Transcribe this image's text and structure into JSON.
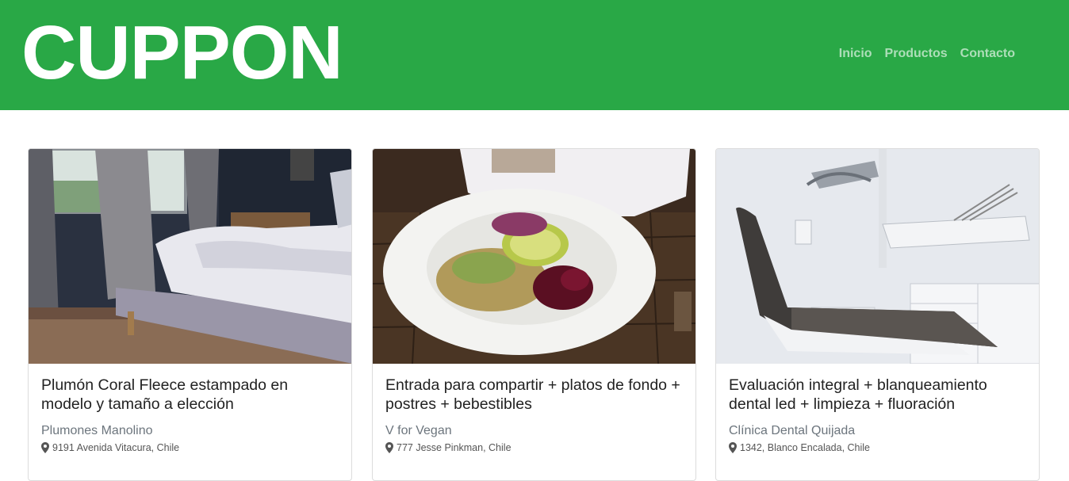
{
  "header": {
    "logo": "CUPPON",
    "nav": [
      {
        "label": "Inicio"
      },
      {
        "label": "Productos"
      },
      {
        "label": "Contacto"
      }
    ]
  },
  "colors": {
    "brand_green": "#29a846",
    "nav_link": "rgba(255,255,255,0.62)",
    "muted_text": "#6c757d"
  },
  "cards": [
    {
      "image": "bedroom-bed-photo",
      "title": "Plumón Coral Fleece estampado en modelo y tamaño a elección",
      "seller": "Plumones Manolino",
      "location": "9191 Avenida Vitacura, Chile",
      "location_icon": "map-marker-icon"
    },
    {
      "image": "vegan-salad-bowl-photo",
      "title": "Entrada para compartir + platos de fondo + postres + bebestibles",
      "seller": "V for Vegan",
      "location": "777 Jesse Pinkman, Chile",
      "location_icon": "map-marker-icon"
    },
    {
      "image": "dental-chair-photo",
      "title": "Evaluación integral + blanqueamiento dental led + limpieza + fluoración",
      "seller": "Clínica Dental Quijada",
      "location": "1342, Blanco Encalada, Chile",
      "location_icon": "map-marker-icon"
    }
  ]
}
